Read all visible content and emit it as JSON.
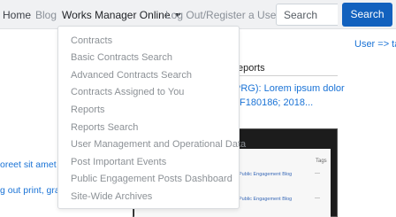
{
  "nav": {
    "home": "Home",
    "blog": "Blog",
    "works_manager": "Works Manager Online",
    "login": "Log Out/Register a User"
  },
  "search": {
    "placeholder": "Search",
    "button": "Search"
  },
  "dropdown": {
    "items": [
      "Contracts",
      "Basic Contracts Search",
      "Advanced Contracts Search",
      "Contracts Assigned to You",
      "Reports",
      "Reports Search",
      "User Management and Operational Data",
      "Post Important Events",
      "Public Engagement Posts Dashboard",
      "Site-Wide Archives"
    ]
  },
  "background": {
    "user_link": "User => ta",
    "reports_heading": "eports",
    "link_line1": "PRG): Lorem ipsum dolor",
    "link_line2": "F180186; 2018...",
    "side_text1": "oreet sit amet",
    "side_text2": "g out print, gra",
    "shot_tags": "Tags",
    "shot_item1": "Public Engagement Blog",
    "shot_item2": "Public Engagement Blog",
    "shot_dash": "—"
  },
  "colors": {
    "accent": "#1261be",
    "link": "#1a73d6",
    "navbar_bg": "#f0f1f3"
  }
}
